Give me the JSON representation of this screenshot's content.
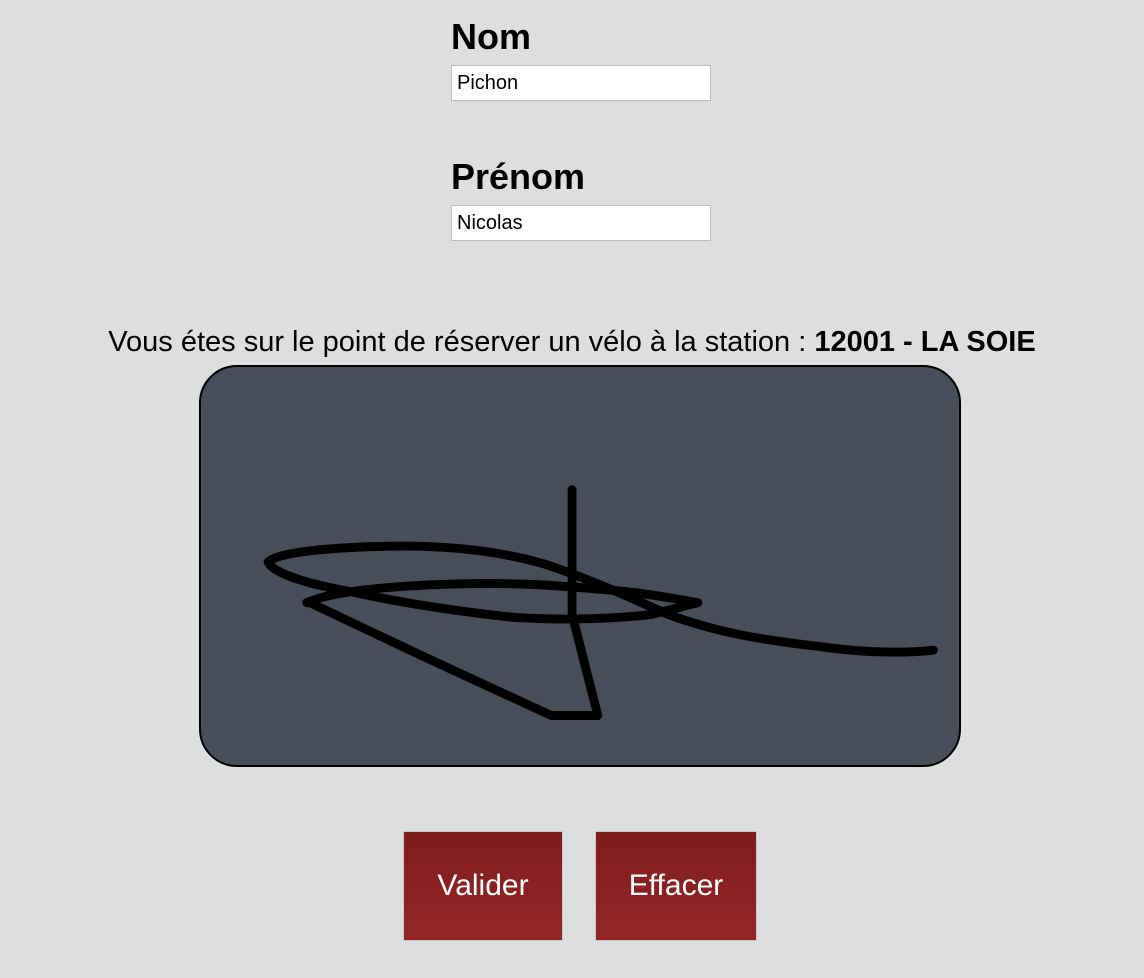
{
  "form": {
    "nom_label": "Nom",
    "nom_value": "Pichon",
    "prenom_label": "Prénom",
    "prenom_value": "Nicolas"
  },
  "reservation": {
    "message": "Vous étes sur le point de réserver un vélo à la station : ",
    "station": "12001 - LA SOIE"
  },
  "signature": {
    "background": "#474e59",
    "stroke_color": "#000000"
  },
  "buttons": {
    "validate_label": "Valider",
    "clear_label": "Effacer",
    "color": "#8b2223"
  }
}
